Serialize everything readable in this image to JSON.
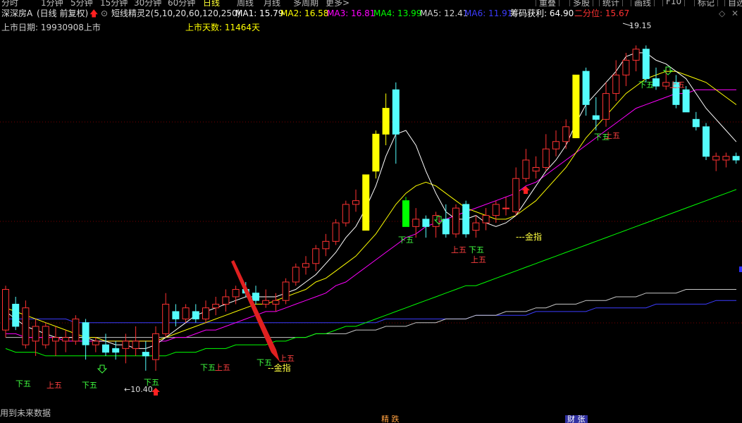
{
  "top_tabs": [
    "分时",
    "1分钟",
    "5分钟",
    "15分钟",
    "30分钟",
    "60分钟",
    "日线",
    "周线",
    "月线",
    "多周期",
    "更多>"
  ],
  "active_tab": "日线",
  "right_buttons": [
    "重叠",
    "多股",
    "统计",
    "画线",
    "F10",
    "标记",
    "自选"
  ],
  "header": {
    "stock_name": "深深房A",
    "mode": "(日线 前复权)",
    "indicator": "短线精灵2(5,10,20,60,120,250)",
    "ma1": "MA1: 15.79",
    "ma2": "MA2: 16.58",
    "ma3": "MA3: 16.81",
    "ma4": "MA4: 13.99",
    "ma5": "MA5: 12.41",
    "ma6": "MA6: 11.91",
    "chip": "筹码获利: 64.90",
    "quantile": "二分位: 15.67"
  },
  "row2": {
    "listing_date": "上市日期: 19930908上市",
    "listing_days": "上市天数: 11464天"
  },
  "annotations": {
    "high": "19.15",
    "low": "←10.40",
    "golden1": "--金指",
    "golden2": "---金指",
    "future_note": "用到未来数据",
    "tag_up": "上五",
    "tag_down": "下五",
    "bottom_tag1": "精 跌",
    "bottom_tag2": "财 张"
  },
  "colors": {
    "up": "#ff3232",
    "down": "#54fcfc",
    "yellow": "#ffff00",
    "green": "#00ff00",
    "ma1": "#ffffff",
    "ma2": "#ffff00",
    "ma3": "#ff00ff",
    "ma4": "#00ff00",
    "ma5": "#c8c8c8",
    "ma6": "#3c3cff",
    "grid": "#7a0000"
  },
  "chart_data": {
    "type": "candlestick",
    "price_range": [
      9.5,
      19.8
    ],
    "candles": [
      {
        "o": 12.6,
        "h": 12.7,
        "l": 11.3,
        "c": 11.5,
        "col": "up"
      },
      {
        "o": 11.6,
        "h": 12.4,
        "l": 11.5,
        "c": 12.2,
        "col": "down"
      },
      {
        "o": 12.1,
        "h": 12.3,
        "l": 11.0,
        "c": 11.1,
        "col": "up"
      },
      {
        "o": 11.2,
        "h": 11.8,
        "l": 10.8,
        "c": 11.6,
        "col": "up"
      },
      {
        "o": 11.6,
        "h": 11.7,
        "l": 11.0,
        "c": 11.1,
        "col": "up"
      },
      {
        "o": 11.2,
        "h": 11.6,
        "l": 10.8,
        "c": 11.3,
        "col": "up"
      },
      {
        "o": 11.3,
        "h": 11.5,
        "l": 10.9,
        "c": 11.2,
        "col": "up"
      },
      {
        "o": 11.2,
        "h": 11.9,
        "l": 11.1,
        "c": 11.8,
        "col": "up"
      },
      {
        "o": 11.7,
        "h": 11.8,
        "l": 10.7,
        "c": 11.1,
        "col": "down"
      },
      {
        "o": 11.1,
        "h": 11.3,
        "l": 10.9,
        "c": 11.2,
        "col": "up"
      },
      {
        "o": 11.1,
        "h": 11.4,
        "l": 10.8,
        "c": 10.9,
        "col": "down"
      },
      {
        "o": 10.9,
        "h": 11.2,
        "l": 10.7,
        "c": 11.0,
        "col": "down"
      },
      {
        "o": 11.0,
        "h": 11.4,
        "l": 10.6,
        "c": 11.2,
        "col": "up"
      },
      {
        "o": 11.2,
        "h": 11.6,
        "l": 10.8,
        "c": 11.0,
        "col": "up"
      },
      {
        "o": 10.9,
        "h": 11.2,
        "l": 10.4,
        "c": 10.8,
        "col": "down"
      },
      {
        "o": 10.7,
        "h": 11.6,
        "l": 10.4,
        "c": 11.4,
        "col": "up"
      },
      {
        "o": 11.4,
        "h": 12.5,
        "l": 11.3,
        "c": 12.2,
        "col": "up"
      },
      {
        "o": 12.0,
        "h": 12.2,
        "l": 11.6,
        "c": 11.8,
        "col": "down"
      },
      {
        "o": 11.8,
        "h": 12.2,
        "l": 11.7,
        "c": 12.1,
        "col": "up"
      },
      {
        "o": 12.0,
        "h": 12.2,
        "l": 11.7,
        "c": 11.8,
        "col": "down"
      },
      {
        "o": 11.8,
        "h": 12.3,
        "l": 11.7,
        "c": 12.1,
        "col": "up"
      },
      {
        "o": 12.1,
        "h": 12.4,
        "l": 11.9,
        "c": 12.2,
        "col": "up"
      },
      {
        "o": 12.2,
        "h": 12.6,
        "l": 12.0,
        "c": 12.4,
        "col": "up"
      },
      {
        "o": 12.4,
        "h": 12.7,
        "l": 12.2,
        "c": 12.6,
        "col": "up"
      },
      {
        "o": 12.6,
        "h": 12.8,
        "l": 12.4,
        "c": 12.5,
        "col": "down"
      },
      {
        "o": 12.5,
        "h": 12.7,
        "l": 12.2,
        "c": 12.3,
        "col": "down"
      },
      {
        "o": 12.3,
        "h": 12.6,
        "l": 12.1,
        "c": 12.2,
        "col": "up"
      },
      {
        "o": 12.2,
        "h": 12.5,
        "l": 12.0,
        "c": 12.3,
        "col": "up"
      },
      {
        "o": 12.3,
        "h": 12.9,
        "l": 12.2,
        "c": 12.8,
        "col": "up"
      },
      {
        "o": 12.8,
        "h": 13.3,
        "l": 12.7,
        "c": 13.2,
        "col": "up"
      },
      {
        "o": 13.2,
        "h": 13.5,
        "l": 13.0,
        "c": 13.3,
        "col": "up"
      },
      {
        "o": 13.3,
        "h": 13.8,
        "l": 13.1,
        "c": 13.7,
        "col": "up"
      },
      {
        "o": 13.7,
        "h": 14.1,
        "l": 13.5,
        "c": 13.9,
        "col": "up"
      },
      {
        "o": 13.9,
        "h": 14.5,
        "l": 13.8,
        "c": 14.4,
        "col": "up"
      },
      {
        "o": 14.4,
        "h": 15.0,
        "l": 14.3,
        "c": 14.9,
        "col": "up"
      },
      {
        "o": 14.9,
        "h": 15.3,
        "l": 14.7,
        "c": 15.0,
        "col": "up"
      },
      {
        "o": 14.2,
        "h": 15.7,
        "l": 14.2,
        "c": 15.7,
        "col": "yellow"
      },
      {
        "o": 15.8,
        "h": 16.9,
        "l": 15.6,
        "c": 16.8,
        "col": "yellow"
      },
      {
        "o": 16.8,
        "h": 17.9,
        "l": 16.5,
        "c": 17.5,
        "col": "yellow"
      },
      {
        "o": 16.8,
        "h": 18.2,
        "l": 16.0,
        "c": 18.0,
        "col": "down"
      },
      {
        "o": 15.0,
        "h": 15.1,
        "l": 14.3,
        "c": 14.3,
        "col": "green"
      },
      {
        "o": 14.3,
        "h": 14.8,
        "l": 14.0,
        "c": 14.5,
        "col": "up"
      },
      {
        "o": 14.5,
        "h": 14.6,
        "l": 14.0,
        "c": 14.3,
        "col": "down"
      },
      {
        "o": 14.3,
        "h": 14.7,
        "l": 14.0,
        "c": 14.6,
        "col": "up"
      },
      {
        "o": 14.5,
        "h": 14.9,
        "l": 14.0,
        "c": 14.1,
        "col": "down"
      },
      {
        "o": 14.1,
        "h": 14.9,
        "l": 14.0,
        "c": 14.8,
        "col": "up"
      },
      {
        "o": 14.9,
        "h": 15.0,
        "l": 14.0,
        "c": 14.1,
        "col": "down"
      },
      {
        "o": 14.2,
        "h": 14.6,
        "l": 14.0,
        "c": 14.4,
        "col": "up"
      },
      {
        "o": 14.4,
        "h": 14.8,
        "l": 14.2,
        "c": 14.6,
        "col": "up"
      },
      {
        "o": 14.6,
        "h": 15.0,
        "l": 14.4,
        "c": 14.9,
        "col": "up"
      },
      {
        "o": 14.8,
        "h": 15.1,
        "l": 14.6,
        "c": 14.8,
        "col": "up"
      },
      {
        "o": 14.7,
        "h": 15.9,
        "l": 14.6,
        "c": 15.6,
        "col": "up"
      },
      {
        "o": 15.6,
        "h": 16.4,
        "l": 15.5,
        "c": 16.1,
        "col": "up"
      },
      {
        "o": 15.8,
        "h": 16.2,
        "l": 15.6,
        "c": 15.9,
        "col": "up"
      },
      {
        "o": 15.9,
        "h": 16.8,
        "l": 15.8,
        "c": 16.4,
        "col": "up"
      },
      {
        "o": 16.4,
        "h": 16.9,
        "l": 16.2,
        "c": 16.6,
        "col": "up"
      },
      {
        "o": 16.6,
        "h": 17.2,
        "l": 16.4,
        "c": 17.0,
        "col": "up"
      },
      {
        "o": 16.7,
        "h": 18.4,
        "l": 16.7,
        "c": 18.4,
        "col": "yellow"
      },
      {
        "o": 18.5,
        "h": 18.6,
        "l": 17.3,
        "c": 17.6,
        "col": "down"
      },
      {
        "o": 17.2,
        "h": 17.8,
        "l": 16.9,
        "c": 17.3,
        "col": "down"
      },
      {
        "o": 17.2,
        "h": 18.2,
        "l": 17.0,
        "c": 17.9,
        "col": "up"
      },
      {
        "o": 17.9,
        "h": 18.8,
        "l": 17.7,
        "c": 18.4,
        "col": "up"
      },
      {
        "o": 18.4,
        "h": 19.0,
        "l": 18.1,
        "c": 18.8,
        "col": "up"
      },
      {
        "o": 18.8,
        "h": 19.2,
        "l": 18.5,
        "c": 19.1,
        "col": "up"
      },
      {
        "o": 19.1,
        "h": 19.2,
        "l": 18.2,
        "c": 18.3,
        "col": "down"
      },
      {
        "o": 18.3,
        "h": 18.6,
        "l": 18.0,
        "c": 18.1,
        "col": "down"
      },
      {
        "o": 18.1,
        "h": 18.6,
        "l": 18.0,
        "c": 18.2,
        "col": "up"
      },
      {
        "o": 18.2,
        "h": 18.4,
        "l": 17.5,
        "c": 17.6,
        "col": "down"
      },
      {
        "o": 18.0,
        "h": 18.1,
        "l": 17.4,
        "c": 17.4,
        "col": "down"
      },
      {
        "o": 17.2,
        "h": 17.4,
        "l": 16.9,
        "c": 17.0,
        "col": "down"
      },
      {
        "o": 17.0,
        "h": 17.1,
        "l": 16.1,
        "c": 16.2,
        "col": "down"
      },
      {
        "o": 16.2,
        "h": 16.3,
        "l": 15.8,
        "c": 16.1,
        "col": "up"
      },
      {
        "o": 16.1,
        "h": 16.3,
        "l": 15.9,
        "c": 16.2,
        "col": "up"
      },
      {
        "o": 16.2,
        "h": 16.3,
        "l": 16.0,
        "c": 16.1,
        "col": "down"
      }
    ],
    "ma_lines": {
      "ma1": [
        12.0,
        11.8,
        11.6,
        11.5,
        11.4,
        11.3,
        11.3,
        11.3,
        11.3,
        11.2,
        11.2,
        11.1,
        11.1,
        11.0,
        11.0,
        11.1,
        11.3,
        11.5,
        11.7,
        11.9,
        12.0,
        12.1,
        12.2,
        12.3,
        12.4,
        12.4,
        12.4,
        12.4,
        12.5,
        12.6,
        12.8,
        13.0,
        13.3,
        13.6,
        14.0,
        14.3,
        14.8,
        15.4,
        16.2,
        16.8,
        16.9,
        16.5,
        15.8,
        15.2,
        14.7,
        14.5,
        14.5,
        14.6,
        14.4,
        14.3,
        14.4,
        14.6,
        15.0,
        15.4,
        15.8,
        16.1,
        16.5,
        17.1,
        17.6,
        17.9,
        18.2,
        18.5,
        18.9,
        19.0,
        19.0,
        18.8,
        18.7,
        18.5,
        18.3,
        17.9,
        17.5,
        17.2,
        16.9,
        16.6
      ],
      "ma2": [
        12.1,
        12.0,
        11.9,
        11.8,
        11.7,
        11.6,
        11.5,
        11.4,
        11.3,
        11.3,
        11.2,
        11.2,
        11.2,
        11.2,
        11.2,
        11.2,
        11.3,
        11.4,
        11.5,
        11.6,
        11.7,
        11.8,
        11.9,
        12.0,
        12.1,
        12.2,
        12.2,
        12.3,
        12.4,
        12.5,
        12.6,
        12.8,
        12.9,
        13.1,
        13.3,
        13.5,
        13.8,
        14.1,
        14.5,
        14.9,
        15.2,
        15.4,
        15.5,
        15.4,
        15.2,
        15.0,
        14.8,
        14.7,
        14.6,
        14.5,
        14.5,
        14.6,
        14.8,
        15.0,
        15.3,
        15.6,
        15.9,
        16.3,
        16.7,
        17.0,
        17.3,
        17.6,
        17.9,
        18.1,
        18.3,
        18.4,
        18.5,
        18.5,
        18.4,
        18.3,
        18.2,
        18.0,
        17.8,
        17.6
      ],
      "ma3": [
        11.4,
        11.4,
        11.3,
        11.3,
        11.3,
        11.3,
        11.2,
        11.2,
        11.2,
        11.2,
        11.2,
        11.2,
        11.2,
        11.2,
        11.2,
        11.2,
        11.2,
        11.3,
        11.3,
        11.4,
        11.5,
        11.5,
        11.6,
        11.7,
        11.8,
        11.9,
        12.0,
        12.0,
        12.1,
        12.2,
        12.3,
        12.4,
        12.5,
        12.7,
        12.8,
        13.0,
        13.2,
        13.4,
        13.6,
        13.8,
        14.0,
        14.1,
        14.3,
        14.4,
        14.5,
        14.6,
        14.7,
        14.8,
        14.9,
        15.0,
        15.1,
        15.2,
        15.4,
        15.5,
        15.7,
        15.9,
        16.1,
        16.3,
        16.5,
        16.7,
        16.9,
        17.1,
        17.3,
        17.5,
        17.6,
        17.7,
        17.8,
        17.9,
        17.9,
        18.0,
        18.0,
        18.0,
        18.0,
        18.0
      ],
      "ma4": [
        11.0,
        10.9,
        10.9,
        10.9,
        10.8,
        10.8,
        10.8,
        10.8,
        10.8,
        10.8,
        10.8,
        10.8,
        10.8,
        10.8,
        10.8,
        10.8,
        10.8,
        10.9,
        10.9,
        10.9,
        11.0,
        11.0,
        11.0,
        11.1,
        11.1,
        11.1,
        11.1,
        11.2,
        11.2,
        11.3,
        11.3,
        11.4,
        11.4,
        11.5,
        11.6,
        11.6,
        11.7,
        11.8,
        11.9,
        12.0,
        12.1,
        12.2,
        12.3,
        12.4,
        12.5,
        12.6,
        12.7,
        12.7,
        12.8,
        12.9,
        13.0,
        13.1,
        13.2,
        13.3,
        13.4,
        13.5,
        13.6,
        13.7,
        13.8,
        13.9,
        14.0,
        14.1,
        14.2,
        14.3,
        14.4,
        14.5,
        14.6,
        14.7,
        14.8,
        14.9,
        15.0,
        15.1,
        15.2,
        15.3
      ],
      "ma5": [
        11.3,
        11.3,
        11.3,
        11.3,
        11.3,
        11.3,
        11.3,
        11.3,
        11.3,
        11.3,
        11.3,
        11.3,
        11.3,
        11.3,
        11.3,
        11.3,
        11.3,
        11.3,
        11.3,
        11.3,
        11.3,
        11.3,
        11.3,
        11.3,
        11.3,
        11.3,
        11.3,
        11.3,
        11.3,
        11.3,
        11.3,
        11.4,
        11.4,
        11.4,
        11.4,
        11.5,
        11.5,
        11.5,
        11.6,
        11.6,
        11.6,
        11.7,
        11.7,
        11.7,
        11.8,
        11.8,
        11.8,
        11.9,
        11.9,
        11.9,
        12.0,
        12.0,
        12.0,
        12.1,
        12.1,
        12.2,
        12.2,
        12.2,
        12.3,
        12.3,
        12.3,
        12.4,
        12.4,
        12.4,
        12.5,
        12.5,
        12.5,
        12.5,
        12.6,
        12.6,
        12.6,
        12.6,
        12.6,
        12.6
      ],
      "ma6": [
        11.8,
        11.8,
        11.8,
        11.8,
        11.8,
        11.8,
        11.8,
        11.7,
        11.7,
        11.7,
        11.7,
        11.7,
        11.7,
        11.7,
        11.7,
        11.7,
        11.7,
        11.7,
        11.7,
        11.7,
        11.7,
        11.7,
        11.7,
        11.7,
        11.7,
        11.7,
        11.7,
        11.7,
        11.7,
        11.7,
        11.7,
        11.7,
        11.7,
        11.7,
        11.7,
        11.7,
        11.7,
        11.7,
        11.8,
        11.8,
        11.8,
        11.8,
        11.8,
        11.8,
        11.8,
        11.8,
        11.8,
        11.9,
        11.9,
        11.9,
        11.9,
        11.9,
        11.9,
        12.0,
        12.0,
        12.0,
        12.0,
        12.0,
        12.0,
        12.1,
        12.1,
        12.1,
        12.1,
        12.1,
        12.1,
        12.2,
        12.2,
        12.2,
        12.2,
        12.2,
        12.2,
        12.3,
        12.3,
        12.3
      ]
    }
  }
}
